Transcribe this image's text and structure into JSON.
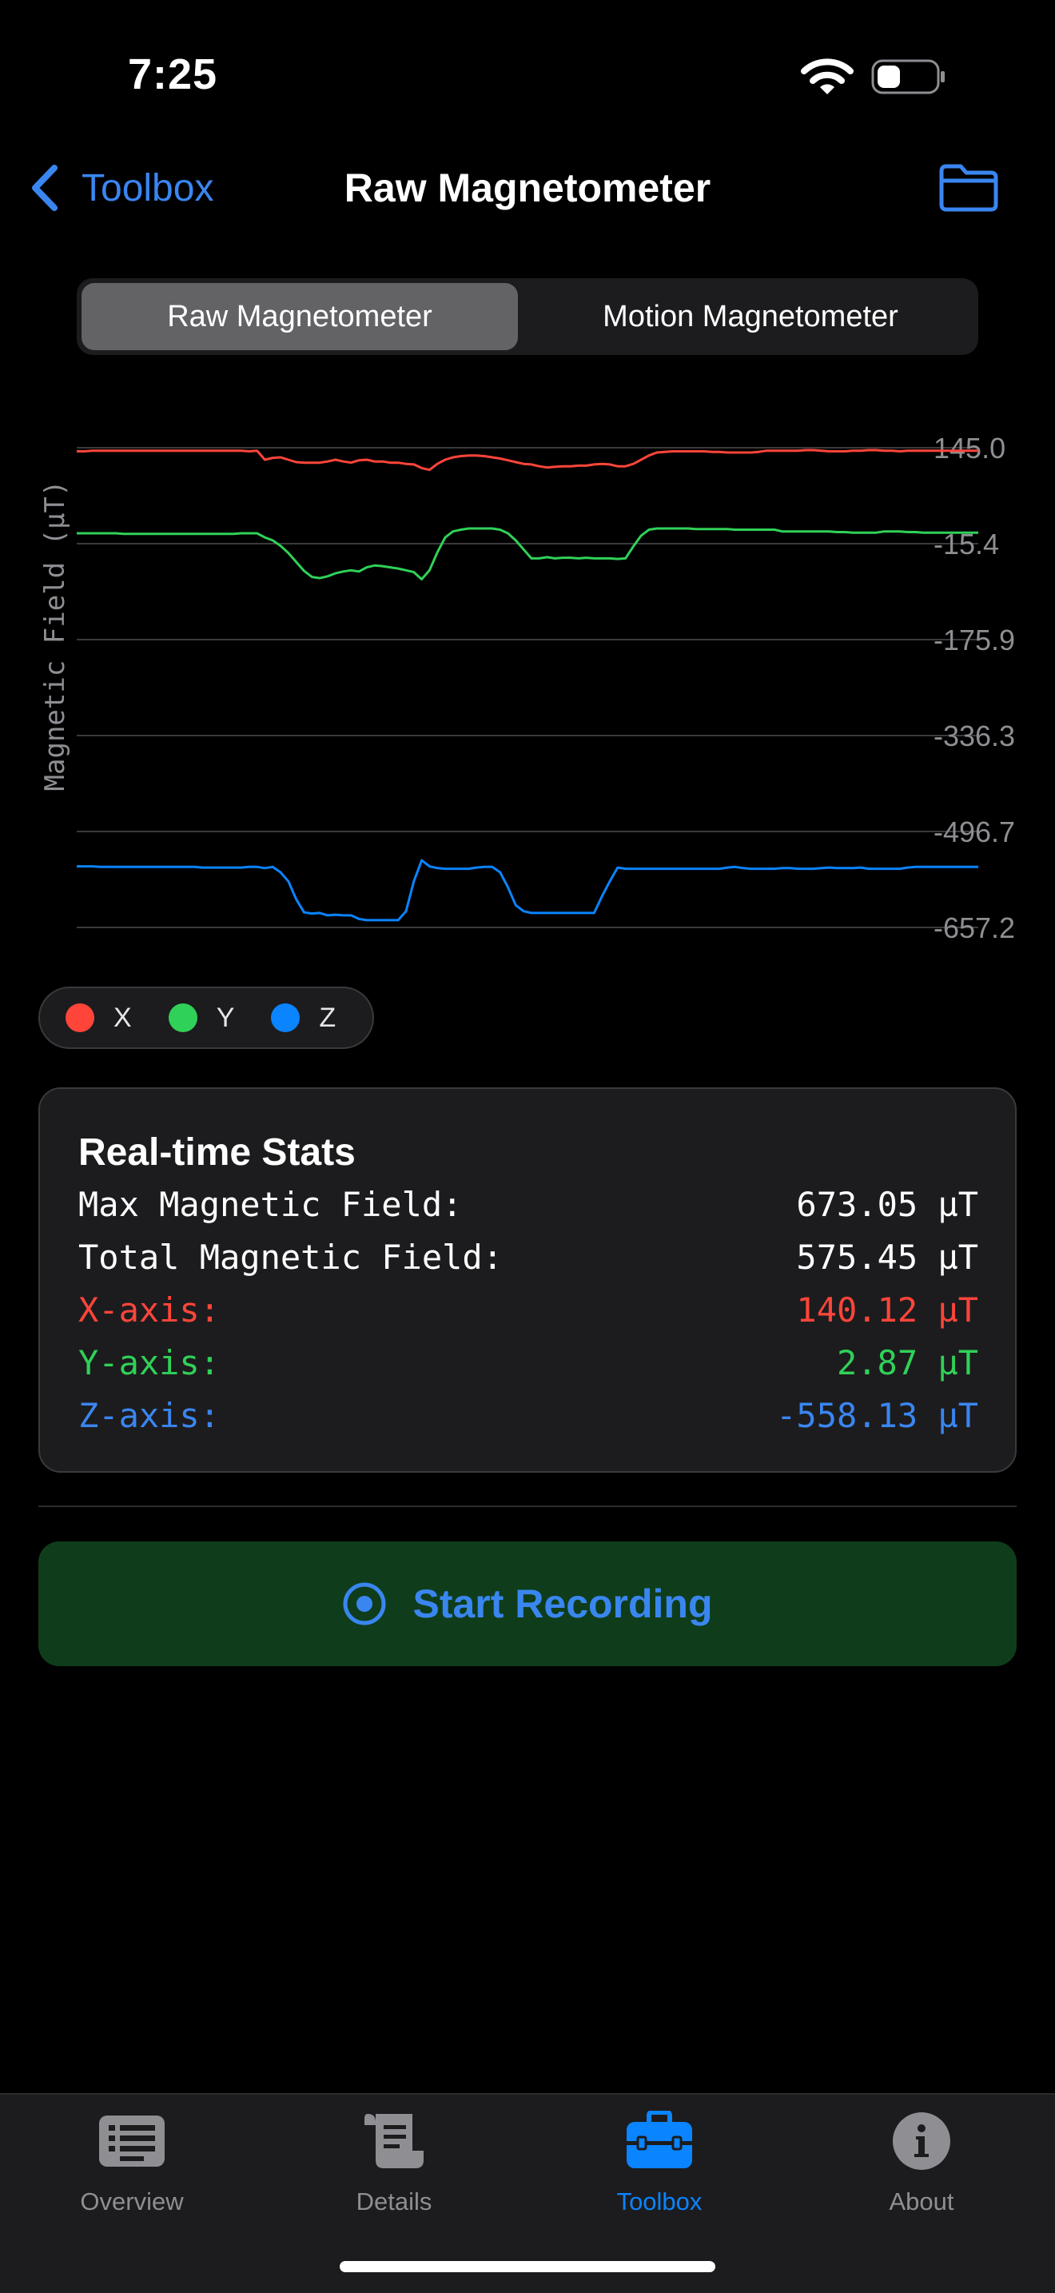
{
  "status_bar": {
    "time": "7:25"
  },
  "nav": {
    "back_label": "Toolbox",
    "title": "Raw Magnetometer"
  },
  "segmented": {
    "options": [
      "Raw Magnetometer",
      "Motion Magnetometer"
    ],
    "selected": "Raw Magnetometer"
  },
  "chart_data": {
    "type": "line",
    "title": "",
    "xlabel": "",
    "ylabel": "Magnetic Field (µT)",
    "ylim": [
      -657.2,
      145.0
    ],
    "yticks": [
      "145.0",
      "-15.4",
      "-175.9",
      "-336.3",
      "-496.7",
      "-657.2"
    ],
    "grid": true,
    "legend": "below-left",
    "colors": {
      "X": "#ff453a",
      "Y": "#30d158",
      "Z": "#0a84ff"
    },
    "series": [
      {
        "name": "X",
        "values": [
          139,
          139,
          140,
          140,
          140,
          140,
          140,
          140,
          140,
          140,
          140,
          140,
          140,
          140,
          140,
          140,
          140,
          140,
          140,
          140,
          140,
          140,
          139,
          140,
          125,
          128,
          129,
          125,
          121,
          120,
          120,
          120,
          122,
          125,
          122,
          120,
          124,
          125,
          122,
          122,
          120,
          120,
          118,
          117,
          111,
          108,
          118,
          125,
          129,
          131,
          132,
          132,
          131,
          129,
          127,
          124,
          121,
          118,
          117,
          114,
          112,
          113,
          114,
          114,
          115,
          115,
          117,
          118,
          117,
          114,
          114,
          118,
          125,
          132,
          137,
          138,
          139,
          139,
          139,
          139,
          139,
          138,
          138,
          137,
          137,
          137,
          137,
          138,
          140,
          140,
          140,
          140,
          140,
          141,
          141,
          140,
          139,
          139,
          139,
          140,
          140,
          141,
          141,
          140,
          140,
          139,
          140,
          140,
          140,
          140,
          140,
          140,
          140,
          140,
          140,
          140
        ]
      },
      {
        "name": "Y",
        "values": [
          2,
          2,
          2,
          2,
          2,
          2,
          1,
          1,
          1,
          1,
          1,
          1,
          1,
          1,
          1,
          1,
          1,
          1,
          1,
          1,
          1,
          2,
          2,
          2,
          -5,
          -10,
          -19,
          -31,
          -46,
          -61,
          -71,
          -73,
          -70,
          -65,
          -62,
          -60,
          -62,
          -55,
          -52,
          -53,
          -55,
          -57,
          -60,
          -63,
          -75,
          -60,
          -30,
          -5,
          5,
          8,
          10,
          10,
          10,
          10,
          8,
          2,
          -10,
          -25,
          -40,
          -40,
          -38,
          -40,
          -39,
          -39,
          -40,
          -39,
          -40,
          -40,
          -40,
          -41,
          -40,
          -20,
          -2,
          8,
          10,
          10,
          10,
          10,
          10,
          9,
          9,
          9,
          9,
          9,
          8,
          8,
          8,
          8,
          8,
          8,
          5,
          5,
          5,
          5,
          5,
          5,
          5,
          4,
          4,
          3,
          3,
          3,
          3,
          5,
          5,
          5,
          4,
          4,
          3,
          3,
          3,
          3,
          3,
          3,
          3,
          3
        ]
      },
      {
        "name": "Z",
        "values": [
          -555,
          -555,
          -555,
          -556,
          -556,
          -556,
          -556,
          -556,
          -556,
          -556,
          -556,
          -556,
          -556,
          -556,
          -556,
          -556,
          -557,
          -557,
          -557,
          -557,
          -557,
          -557,
          -556,
          -556,
          -558,
          -556,
          -565,
          -580,
          -610,
          -632,
          -634,
          -633,
          -637,
          -636,
          -637,
          -637,
          -643,
          -645,
          -645,
          -645,
          -645,
          -645,
          -630,
          -580,
          -545,
          -555,
          -558,
          -559,
          -559,
          -559,
          -559,
          -557,
          -556,
          -556,
          -565,
          -590,
          -620,
          -630,
          -633,
          -633,
          -633,
          -633,
          -633,
          -633,
          -633,
          -633,
          -633,
          -605,
          -580,
          -557,
          -559,
          -559,
          -559,
          -559,
          -559,
          -559,
          -559,
          -559,
          -559,
          -559,
          -559,
          -559,
          -559,
          -557,
          -556,
          -558,
          -559,
          -559,
          -559,
          -559,
          -558,
          -558,
          -559,
          -559,
          -559,
          -558,
          -557,
          -558,
          -558,
          -558,
          -557,
          -559,
          -559,
          -559,
          -559,
          -559,
          -557,
          -556,
          -556,
          -556,
          -556,
          -556,
          -556,
          -556,
          -556,
          -556
        ]
      }
    ]
  },
  "legend": [
    {
      "label": "X",
      "color": "#ff453a"
    },
    {
      "label": "Y",
      "color": "#30d158"
    },
    {
      "label": "Z",
      "color": "#0a84ff"
    }
  ],
  "stats": {
    "title": "Real-time Stats",
    "rows": [
      {
        "label": "Max Magnetic Field:",
        "value": "673.05 µT",
        "color": "#ffffff"
      },
      {
        "label": "Total Magnetic Field:",
        "value": "575.45 µT",
        "color": "#ffffff"
      },
      {
        "label": "X-axis:",
        "value": "140.12 µT",
        "color": "#ff453a"
      },
      {
        "label": "Y-axis:",
        "value": "2.87 µT",
        "color": "#30d158"
      },
      {
        "label": "Z-axis:",
        "value": "-558.13 µT",
        "color": "#3a86f0"
      }
    ]
  },
  "record_button": {
    "label": "Start Recording",
    "icon": "record-circle-icon"
  },
  "tabs": [
    {
      "label": "Overview",
      "icon": "list-icon",
      "active": false
    },
    {
      "label": "Details",
      "icon": "scroll-icon",
      "active": false
    },
    {
      "label": "Toolbox",
      "icon": "toolbox-icon",
      "active": true
    },
    {
      "label": "About",
      "icon": "info-circle-icon",
      "active": false
    }
  ],
  "colors": {
    "accent": "#3a86f0",
    "inactive": "#8e8e93",
    "record_bg": "#0f3d1c"
  }
}
